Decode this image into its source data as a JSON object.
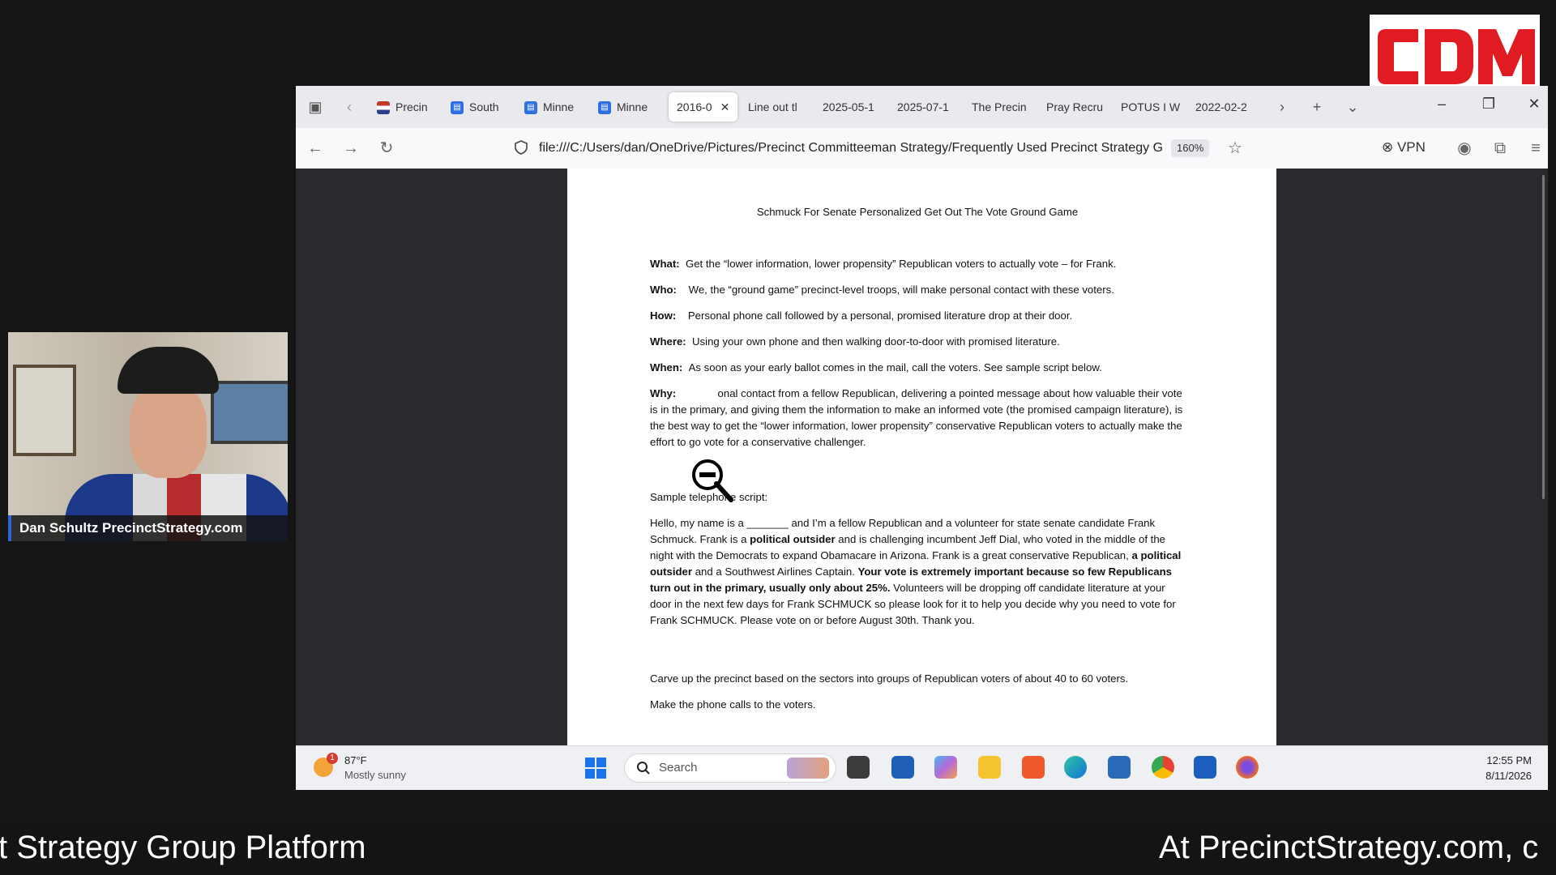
{
  "logo": {
    "text": "CDM",
    "color": "#e11b22"
  },
  "browser": {
    "tabs": [
      {
        "label": "Precin",
        "favicon": "flag-icon"
      },
      {
        "label": "South",
        "favicon": "doc-icon"
      },
      {
        "label": "Minne",
        "favicon": "doc-icon"
      },
      {
        "label": "Minne",
        "favicon": "doc-icon"
      },
      {
        "label": "2016-0",
        "active": true
      },
      {
        "label": "Line out tl"
      },
      {
        "label": "2025-05-1"
      },
      {
        "label": "2025-07-1"
      },
      {
        "label": "The Precin"
      },
      {
        "label": "Pray Recru"
      },
      {
        "label": "POTUS I W"
      },
      {
        "label": "2022-02-2"
      }
    ],
    "url": "file:///C:/Users/dan/OneDrive/Pictures/Precinct Committeeman Strategy/Frequently Used Precinct Strategy G",
    "zoom": "160%",
    "vpn_label": "VPN"
  },
  "document": {
    "title": "Schmuck For Senate Personalized Get Out The Vote Ground Game",
    "what_label": "What:",
    "what_text": "Get the “lower information, lower propensity” Republican voters to actually vote – for Frank.",
    "who_label": "Who:",
    "who_text": "We, the “ground game” precinct-level troops, will make personal contact with these voters.",
    "how_label": "How:",
    "how_text": "Personal phone call followed by a personal, promised literature drop at their door.",
    "where_label": "Where:",
    "where_text": "Using your own phone and then walking door-to-door with promised literature.",
    "when_label": "When:",
    "when_text": "As soon as your early ballot comes in the mail, call the voters.  See sample script below.",
    "why_label": "Why:",
    "why_text": "onal contact from a fellow Republican, delivering a pointed message about how valuable their vote is in the primary, and giving them the information to make an informed vote (the promised campaign literature), is the best way to get the “lower information, lower propensity” conservative Republican voters to actually make the effort to go vote for a conservative challenger.",
    "script_heading": "Sample telephone script:",
    "script_1": "Hello, my name is a _______ and I’m a fellow Republican and a volunteer for state senate candidate Frank Schmuck.  Frank is a ",
    "script_b1": "political outsider",
    "script_2": " and is challenging incumbent Jeff Dial, who voted in the middle of the night with the Democrats to expand Obamacare in Arizona.  Frank is a great conservative Republican, ",
    "script_b2": "a political outsider",
    "script_3": " and a Southwest Airlines Captain.  ",
    "script_b3": "Your vote is extremely important because so few Republicans turn out in the primary, usually only about 25%.",
    "script_4": "  Volunteers will be dropping off candidate literature at your door in the next few days for Frank SCHMUCK so please look for it to help you decide why you need to vote for Frank SCHMUCK.  Please vote on or before August 30th.  Thank you.",
    "carve_text": "Carve up the precinct based on the sectors into groups of Republican voters of about 40 to 60 voters.",
    "phone_text": "Make the phone calls to the voters."
  },
  "taskbar": {
    "weather_temp": "87°F",
    "weather_desc": "Mostly sunny",
    "weather_badge": "1",
    "search_placeholder": "Search",
    "time": "12:55 PM",
    "date": "8/11/2026"
  },
  "webcam": {
    "name": "Dan Schultz PrecinctStrategy.com"
  },
  "ticker": {
    "left": "t Strategy Group Platform",
    "right": "At PrecinctStrategy.com, c"
  }
}
